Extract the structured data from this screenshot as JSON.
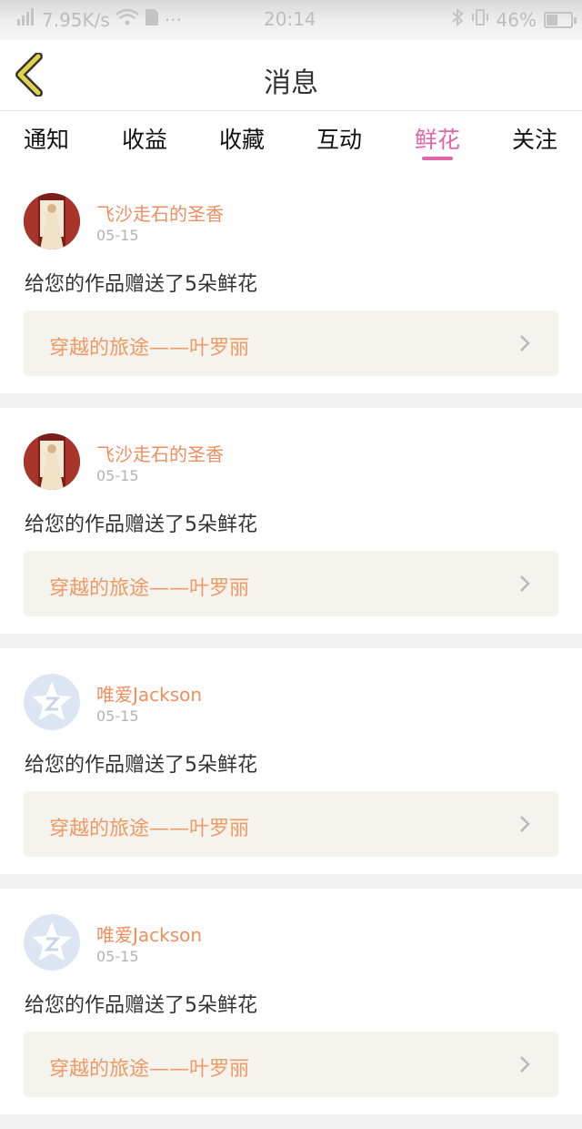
{
  "status_bar": {
    "speed": "7.95K/s",
    "time": "20:14",
    "battery": "46%",
    "battery_level": 0.46
  },
  "nav": {
    "title": "消息",
    "back_icon": "chevron-left-icon",
    "accent_color": "#e066a8",
    "back_color": "#e3d34b"
  },
  "tabs": [
    {
      "label": "通知",
      "active": false
    },
    {
      "label": "收益",
      "active": false
    },
    {
      "label": "收藏",
      "active": false
    },
    {
      "label": "互动",
      "active": false
    },
    {
      "label": "鲜花",
      "active": true
    },
    {
      "label": "关注",
      "active": false
    }
  ],
  "messages": [
    {
      "user": "飞沙走石的圣香",
      "date": "05-15",
      "avatar": "photo-avatar",
      "text": "给您的作品赠送了5朵鲜花",
      "work": "穿越的旅途——叶罗丽"
    },
    {
      "user": "飞沙走石的圣香",
      "date": "05-15",
      "avatar": "photo-avatar",
      "text": "给您的作品赠送了5朵鲜花",
      "work": "穿越的旅途——叶罗丽"
    },
    {
      "user": "唯爱Jackson",
      "date": "05-15",
      "avatar": "qzone-star-avatar",
      "text": "给您的作品赠送了5朵鲜花",
      "work": "穿越的旅途——叶罗丽"
    },
    {
      "user": "唯爱Jackson",
      "date": "05-15",
      "avatar": "qzone-star-avatar",
      "text": "给您的作品赠送了5朵鲜花",
      "work": "穿越的旅途——叶罗丽"
    }
  ]
}
